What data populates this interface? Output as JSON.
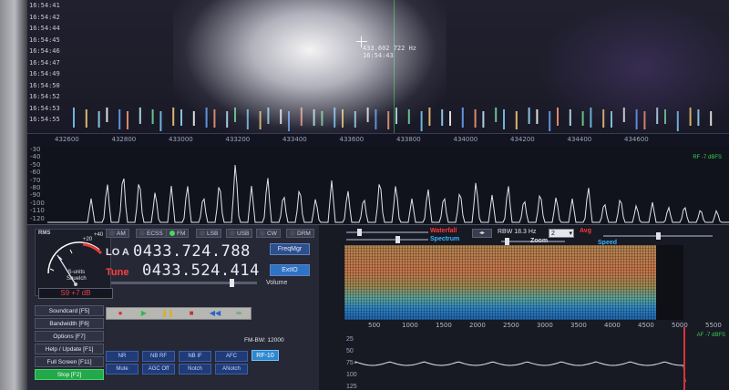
{
  "waterfall": {
    "timestamps": [
      "16:54:41",
      "16:54:42",
      "16:54:44",
      "16:54:45",
      "16:54:46",
      "16:54:47",
      "16:54:49",
      "16:54:50",
      "16:54:52",
      "16:54:53",
      "16:54:55"
    ],
    "cursor_freq": "433.602 722 Hz",
    "cursor_time": "16:54:43"
  },
  "freq_axis": {
    "ticks": [
      "432600",
      "432800",
      "433000",
      "433200",
      "433400",
      "433600",
      "433800",
      "434000",
      "434200",
      "434400",
      "434600"
    ]
  },
  "spectrum": {
    "db_labels": [
      "-30",
      "-40",
      "-50",
      "-60",
      "-70",
      "-80",
      "-90",
      "-100",
      "-110",
      "-120"
    ],
    "rf_readout": "RF -7 dBFS"
  },
  "smeter": {
    "label": "RMS",
    "plus40": "+40",
    "plus20": "+20",
    "sunits": "S-units",
    "squelch": "Squelch",
    "readout": "S9 +7 dB"
  },
  "modes": [
    {
      "label": "AM",
      "on": false
    },
    {
      "label": "ECSS",
      "on": false
    },
    {
      "label": "FM",
      "on": true
    },
    {
      "label": "LSB",
      "on": false
    },
    {
      "label": "USB",
      "on": false
    },
    {
      "label": "CW",
      "on": false
    },
    {
      "label": "DRM",
      "on": false
    }
  ],
  "frequency": {
    "lo_label": "LO A",
    "lo_value": "0433.724.788",
    "tune_label": "Tune",
    "tune_value": "0433.524.414",
    "freqmgr": "FreqMgr",
    "extio": "ExtIO",
    "volume": "Volume"
  },
  "side_buttons": [
    "Soundcard [F5]",
    "Bandwidth [F6]",
    "Options [F7]",
    "Help / Update [F1]",
    "Full Screen [F11]",
    "Stop [F2]"
  ],
  "dsp": {
    "row1": [
      "NR",
      "NB RF",
      "NB IF",
      "AFC"
    ],
    "row2": [
      "Mute",
      "AGC Off",
      "Notch",
      "ANotch"
    ],
    "fm_bw": "FM-BW: 12000",
    "rf_gain": "RF-10"
  },
  "right_panel": {
    "waterfall_label": "Waterfall",
    "spectrum_label": "Spectrum",
    "rbw": "RBW 18.3 Hz",
    "avg_value": "2",
    "avg_label": "Avg",
    "zoom_label": "Zoom",
    "speed_label": "Speed",
    "af_axis": [
      "500",
      "1000",
      "1500",
      "2000",
      "2500",
      "3000",
      "3500",
      "4000",
      "4500",
      "5000",
      "5500"
    ],
    "af_db": [
      "25",
      "50",
      "75",
      "100",
      "125"
    ],
    "af_readout": "AF -7 dBFS"
  }
}
